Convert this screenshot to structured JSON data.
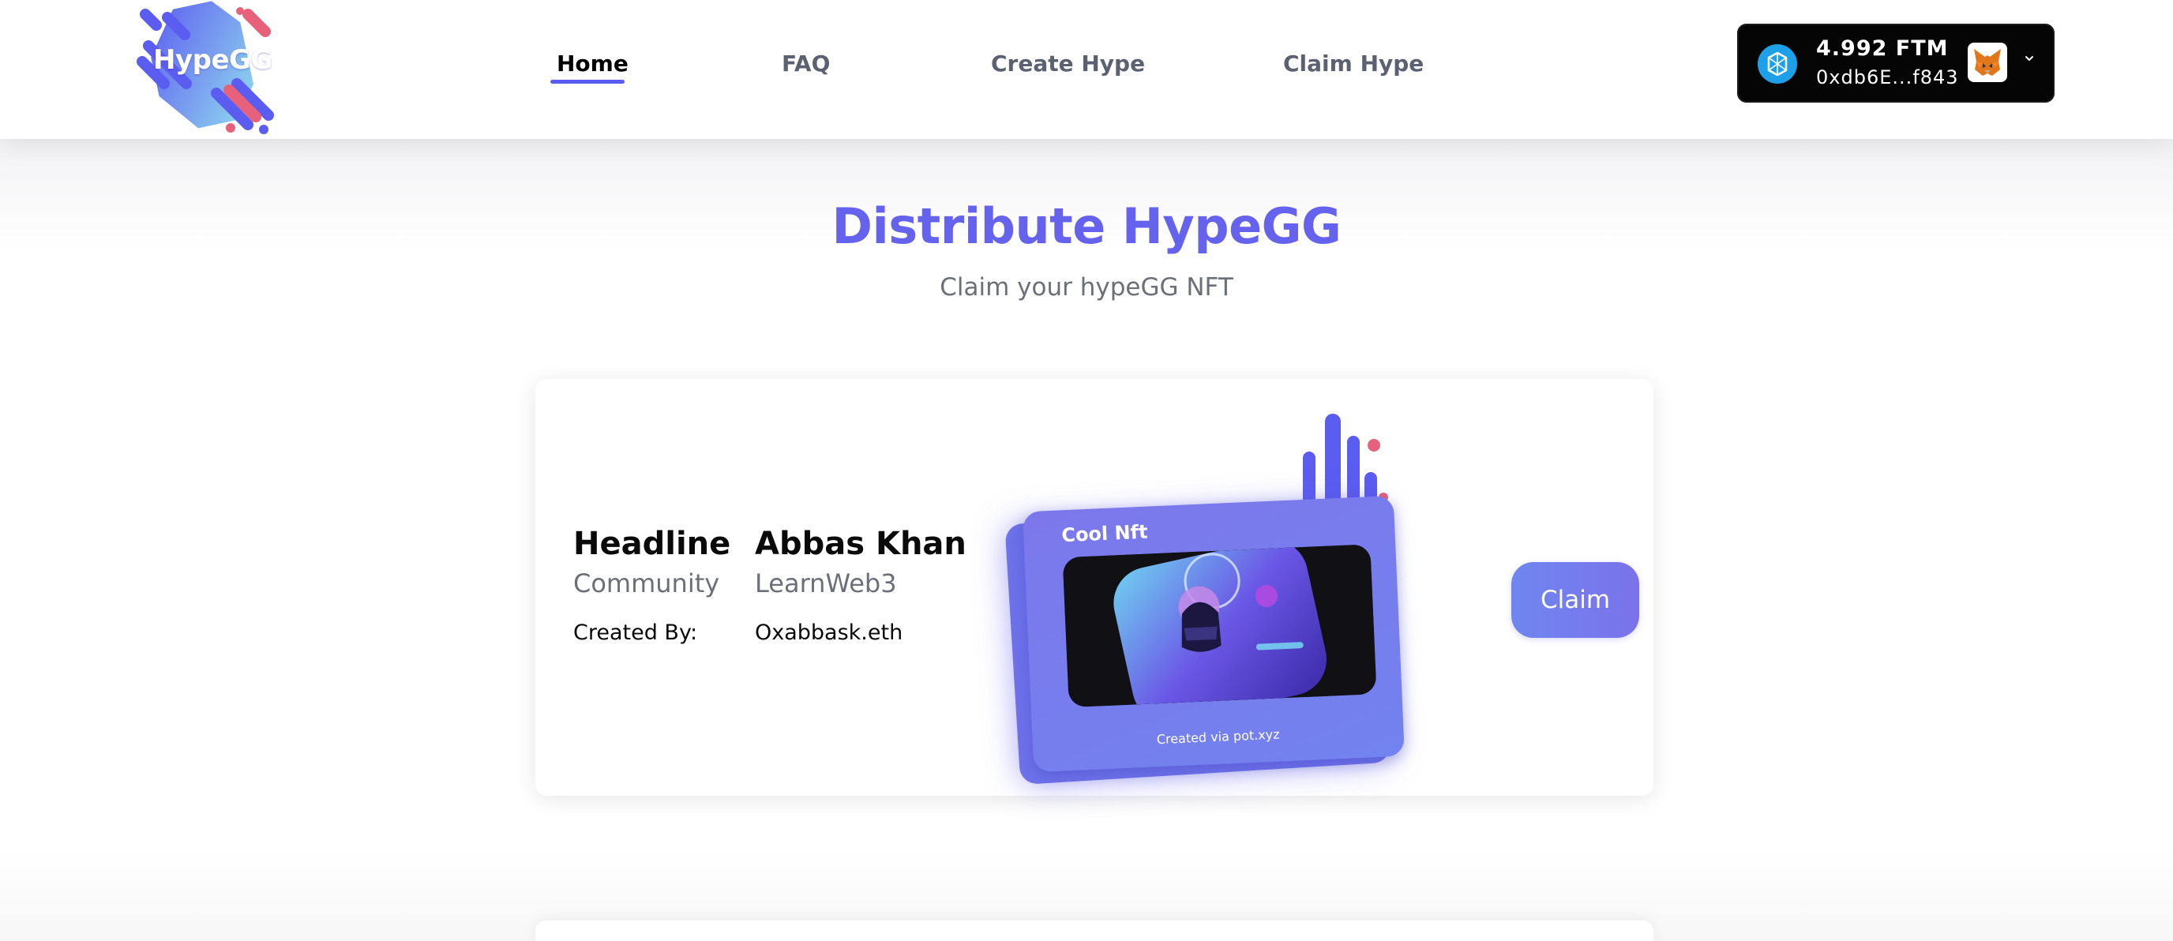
{
  "header": {
    "logo_text": "HypeGG",
    "nav": [
      {
        "label": "Home",
        "active": true
      },
      {
        "label": "FAQ",
        "active": false
      },
      {
        "label": "Create Hype",
        "active": false
      },
      {
        "label": "Claim Hype",
        "active": false
      }
    ],
    "wallet": {
      "balance": "4.992 FTM",
      "address": "0xdb6E...f843",
      "token_icon": "fantom-icon",
      "avatar_icon": "metamask-fox-icon",
      "chevron_icon": "chevron-down-icon"
    }
  },
  "main": {
    "title": "Distribute HypeGG",
    "subtitle": "Claim your hypeGG NFT"
  },
  "card": {
    "col1": {
      "heading": "Headline",
      "sub": "Community",
      "label": "Created By:"
    },
    "col2": {
      "heading": "Abbas Khan",
      "sub": "LearnWeb3",
      "value": "Oxabbask.eth"
    },
    "nft": {
      "title": "Cool Nft",
      "caption": "Created via pot.xyz"
    },
    "claim_label": "Claim"
  },
  "colors": {
    "accent": "#6563ee",
    "nav_underline": "#5b5cf0",
    "wallet_bg": "#050505",
    "nft_card": "#7c78ec",
    "muted_text": "#6b6f78"
  }
}
